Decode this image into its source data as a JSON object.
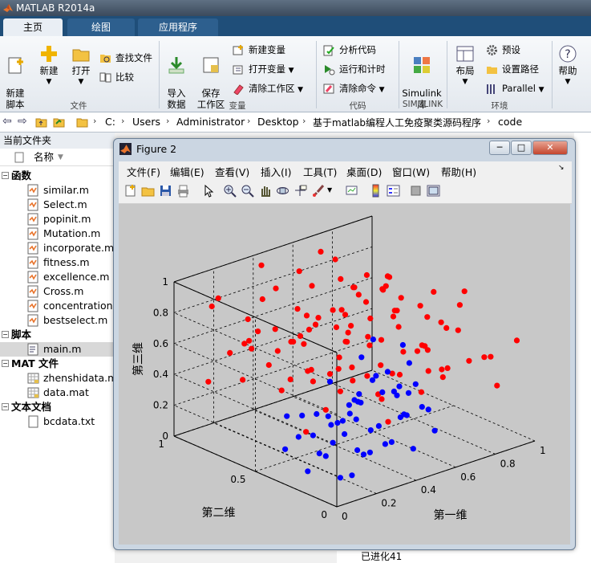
{
  "app": {
    "title": "MATLAB R2014a"
  },
  "tabs": [
    {
      "label": "主页",
      "active": true
    },
    {
      "label": "绘图",
      "active": false
    },
    {
      "label": "应用程序",
      "active": false
    }
  ],
  "ribbon": {
    "new_script": "新建\n脚本",
    "new": "新建",
    "open": "打开",
    "find_files": "查找文件",
    "compare": "比较",
    "group_file": "文件",
    "import_data": "导入\n数据",
    "save_workspace": "保存\n工作区",
    "new_variable": "新建变量",
    "open_variable": "打开变量",
    "clear_workspace": "清除工作区",
    "group_variable": "变量",
    "analyze_code": "分析代码",
    "run_and_time": "运行和计时",
    "clear_commands": "清除命令",
    "group_code": "代码",
    "simulink": "Simulink\n库",
    "group_simulink": "SIMULINK",
    "layout": "布局",
    "preferences": "预设",
    "set_path": "设置路径",
    "parallel": "Parallel",
    "group_env": "环境",
    "help": "帮助"
  },
  "address": {
    "crumbs": [
      "C:",
      "Users",
      "Administrator",
      "Desktop",
      "基于matlab编程人工免疫聚类源码程序",
      "code"
    ]
  },
  "current_folder": {
    "title": "当前文件夹",
    "name_col": "名称",
    "groups": [
      {
        "label": "函数",
        "files": [
          "similar.m",
          "Select.m",
          "popinit.m",
          "Mutation.m",
          "incorporate.m",
          "fitness.m",
          "excellence.m",
          "Cross.m",
          "concentration.m",
          "bestselect.m"
        ]
      },
      {
        "label": "脚本",
        "files": [
          "main.m"
        ]
      },
      {
        "label": "MAT 文件",
        "files": [
          "zhenshidata.mat",
          "data.mat"
        ]
      },
      {
        "label": "文本文档",
        "files": [
          "bcdata.txt"
        ]
      }
    ],
    "selected_file": "main.m"
  },
  "command_window": {
    "visible_line": "已进化41"
  },
  "figure": {
    "title": "Figure 2",
    "menus": [
      "文件(F)",
      "编辑(E)",
      "查看(V)",
      "插入(I)",
      "工具(T)",
      "桌面(D)",
      "窗口(W)",
      "帮助(H)"
    ],
    "toolbar_icons": [
      "new-figure-icon",
      "open-file-icon",
      "save-icon",
      "print-icon",
      "pointer-icon",
      "zoom-in-icon",
      "zoom-out-icon",
      "pan-icon",
      "rotate-3d-icon",
      "data-cursor-icon",
      "brush-icon",
      "link-plot-icon",
      "colorbar-icon",
      "legend-icon",
      "hide-plot-tools-icon",
      "show-plot-tools-icon"
    ]
  },
  "chart_data": {
    "type": "scatter",
    "view": "3d",
    "title": "",
    "xlabel": "第一维",
    "ylabel": "第二维",
    "zlabel": "第三维",
    "xlim": [
      0,
      1
    ],
    "ylim": [
      0,
      1
    ],
    "zlim": [
      0,
      1
    ],
    "x_ticks": [
      "0",
      "0.2",
      "0.4",
      "0.6",
      "0.8",
      "1"
    ],
    "y_ticks": [
      "0",
      "0.5",
      "1"
    ],
    "z_ticks": [
      "0",
      "0.2",
      "0.4",
      "0.6",
      "0.8",
      "1"
    ],
    "grid": true,
    "colors": {
      "cluster_a": "#ff0000",
      "cluster_b": "#0000ff"
    },
    "series": [
      {
        "color": "#ff0000",
        "points": [
          [
            0.55,
            0.3,
            0.9
          ],
          [
            0.6,
            0.45,
            0.95
          ],
          [
            0.5,
            0.5,
            0.98
          ],
          [
            0.7,
            0.55,
            0.88
          ],
          [
            0.45,
            0.7,
            0.92
          ],
          [
            0.65,
            0.8,
            0.96
          ],
          [
            0.8,
            0.65,
            0.85
          ],
          [
            0.75,
            0.4,
            0.8
          ],
          [
            0.9,
            0.5,
            0.78
          ],
          [
            0.85,
            0.75,
            0.7
          ],
          [
            0.4,
            0.4,
            0.82
          ],
          [
            0.3,
            0.55,
            0.86
          ],
          [
            0.35,
            0.8,
            0.9
          ],
          [
            0.2,
            0.7,
            0.94
          ],
          [
            0.55,
            0.9,
            0.88
          ],
          [
            0.15,
            0.45,
            0.8
          ],
          [
            0.25,
            0.25,
            0.85
          ],
          [
            0.1,
            0.85,
            0.92
          ],
          [
            0.4,
            0.95,
            0.96
          ],
          [
            0.7,
            0.95,
            0.92
          ],
          [
            0.5,
            0.2,
            0.7
          ],
          [
            0.65,
            0.25,
            0.65
          ],
          [
            0.8,
            0.3,
            0.68
          ],
          [
            0.9,
            0.35,
            0.6
          ],
          [
            0.95,
            0.6,
            0.55
          ],
          [
            0.85,
            0.9,
            0.6
          ],
          [
            0.6,
            0.7,
            0.7
          ],
          [
            0.45,
            0.55,
            0.72
          ],
          [
            0.3,
            0.35,
            0.68
          ],
          [
            0.2,
            0.15,
            0.75
          ],
          [
            0.1,
            0.3,
            0.7
          ],
          [
            0.05,
            0.6,
            0.78
          ],
          [
            0.15,
            0.95,
            0.8
          ],
          [
            0.35,
            0.65,
            0.66
          ],
          [
            0.55,
            0.6,
            0.62
          ],
          [
            0.7,
            0.8,
            0.58
          ],
          [
            0.95,
            0.8,
            0.5
          ],
          [
            0.9,
            0.15,
            0.52
          ],
          [
            0.75,
            0.1,
            0.58
          ],
          [
            0.6,
            0.05,
            0.62
          ],
          [
            0.4,
            0.1,
            0.64
          ],
          [
            0.25,
            0.05,
            0.6
          ],
          [
            0.1,
            0.1,
            0.66
          ],
          [
            0.05,
            0.4,
            0.55
          ],
          [
            0.15,
            0.6,
            0.58
          ],
          [
            0.3,
            0.85,
            0.62
          ],
          [
            0.5,
            0.85,
            0.68
          ],
          [
            0.65,
            0.6,
            0.55
          ],
          [
            0.8,
            0.45,
            0.5
          ],
          [
            0.95,
            0.25,
            0.45
          ],
          [
            0.85,
            0.05,
            0.4
          ],
          [
            0.7,
            0.2,
            0.45
          ],
          [
            0.55,
            0.4,
            0.5
          ],
          [
            0.4,
            0.3,
            0.54
          ],
          [
            0.25,
            0.45,
            0.5
          ],
          [
            0.1,
            0.7,
            0.46
          ],
          [
            0.2,
            0.9,
            0.5
          ],
          [
            0.45,
            0.75,
            0.52
          ],
          [
            0.6,
            0.9,
            0.48
          ],
          [
            0.8,
            0.7,
            0.42
          ],
          [
            0.95,
            0.95,
            0.38
          ],
          [
            0.9,
            0.6,
            0.35
          ],
          [
            0.75,
            0.85,
            0.36
          ],
          [
            0.55,
            0.95,
            0.4
          ],
          [
            0.35,
            0.95,
            0.44
          ],
          [
            0.05,
            0.85,
            0.4
          ],
          [
            0.15,
            0.25,
            0.45
          ],
          [
            0.35,
            0.15,
            0.48
          ],
          [
            0.55,
            0.15,
            0.44
          ],
          [
            0.75,
            0.35,
            0.4
          ],
          [
            0.9,
            0.45,
            0.3
          ],
          [
            0.65,
            0.45,
            0.38
          ],
          [
            0.45,
            0.45,
            0.42
          ],
          [
            0.3,
            0.65,
            0.4
          ],
          [
            0.7,
            0.65,
            0.45
          ],
          [
            0.5,
            0.65,
            0.35
          ],
          [
            0.85,
            0.85,
            0.75
          ],
          [
            0.25,
            0.85,
            0.72
          ],
          [
            0.6,
            0.35,
            0.75
          ],
          [
            0.4,
            0.6,
            0.78
          ],
          [
            0.95,
            0.05,
            0.65
          ],
          [
            0.05,
            0.05,
            0.85
          ],
          [
            0.35,
            0.45,
            0.92
          ],
          [
            0.75,
            0.6,
            0.9
          ],
          [
            0.2,
            0.4,
            0.62
          ],
          [
            0.65,
            0.15,
            0.85
          ],
          [
            0.85,
            0.25,
            0.92
          ],
          [
            0.45,
            0.2,
            0.95
          ],
          [
            0.15,
            0.75,
            0.65
          ],
          [
            0.55,
            0.8,
            0.58
          ],
          [
            0.7,
            0.75,
            0.78
          ],
          [
            0.9,
            0.7,
            0.65
          ],
          [
            0.8,
            0.95,
            0.7
          ],
          [
            0.3,
            0.05,
            0.4
          ],
          [
            0.05,
            0.25,
            0.35
          ],
          [
            0.95,
            0.4,
            0.72
          ],
          [
            0.6,
            0.55,
            0.82
          ],
          [
            0.4,
            0.85,
            0.45
          ],
          [
            0.1,
            0.5,
            0.88
          ],
          [
            0.5,
            0.05,
            0.78
          ]
        ]
      },
      {
        "color": "#0000ff",
        "points": [
          [
            0.1,
            0.1,
            0.1
          ],
          [
            0.2,
            0.15,
            0.05
          ],
          [
            0.15,
            0.25,
            0.15
          ],
          [
            0.25,
            0.1,
            0.2
          ],
          [
            0.3,
            0.2,
            0.12
          ],
          [
            0.35,
            0.3,
            0.08
          ],
          [
            0.4,
            0.15,
            0.18
          ],
          [
            0.45,
            0.25,
            0.1
          ],
          [
            0.5,
            0.35,
            0.15
          ],
          [
            0.55,
            0.2,
            0.05
          ],
          [
            0.6,
            0.3,
            0.2
          ],
          [
            0.65,
            0.4,
            0.12
          ],
          [
            0.7,
            0.25,
            0.08
          ],
          [
            0.3,
            0.4,
            0.22
          ],
          [
            0.4,
            0.45,
            0.18
          ],
          [
            0.5,
            0.5,
            0.25
          ],
          [
            0.2,
            0.35,
            0.1
          ],
          [
            0.1,
            0.3,
            0.05
          ],
          [
            0.25,
            0.45,
            0.15
          ],
          [
            0.35,
            0.55,
            0.2
          ],
          [
            0.45,
            0.6,
            0.12
          ],
          [
            0.55,
            0.55,
            0.08
          ],
          [
            0.6,
            0.45,
            0.28
          ],
          [
            0.7,
            0.5,
            0.22
          ],
          [
            0.75,
            0.35,
            0.15
          ],
          [
            0.8,
            0.45,
            0.1
          ],
          [
            0.45,
            0.4,
            0.3
          ],
          [
            0.35,
            0.35,
            0.35
          ],
          [
            0.55,
            0.45,
            0.38
          ],
          [
            0.65,
            0.55,
            0.32
          ],
          [
            0.75,
            0.6,
            0.28
          ],
          [
            0.5,
            0.65,
            0.3
          ],
          [
            0.3,
            0.6,
            0.05
          ],
          [
            0.15,
            0.5,
            0.08
          ],
          [
            0.4,
            0.7,
            0.1
          ],
          [
            0.6,
            0.65,
            0.05
          ],
          [
            0.85,
            0.55,
            0.18
          ],
          [
            0.9,
            0.65,
            0.25
          ],
          [
            0.8,
            0.75,
            0.4
          ],
          [
            0.7,
            0.7,
            0.35
          ],
          [
            0.2,
            0.55,
            0.25
          ],
          [
            0.45,
            0.5,
            0.05
          ],
          [
            0.65,
            0.35,
            0.3
          ],
          [
            0.55,
            0.3,
            0.35
          ],
          [
            0.4,
            0.35,
            0.4
          ],
          [
            0.25,
            0.3,
            0.3
          ],
          [
            0.35,
            0.45,
            0.06
          ],
          [
            0.5,
            0.4,
            0.1
          ],
          [
            0.6,
            0.6,
            0.15
          ],
          [
            0.75,
            0.5,
            0.05
          ],
          [
            0.85,
            0.65,
            0.12
          ],
          [
            0.95,
            0.75,
            0.3
          ]
        ]
      }
    ]
  }
}
